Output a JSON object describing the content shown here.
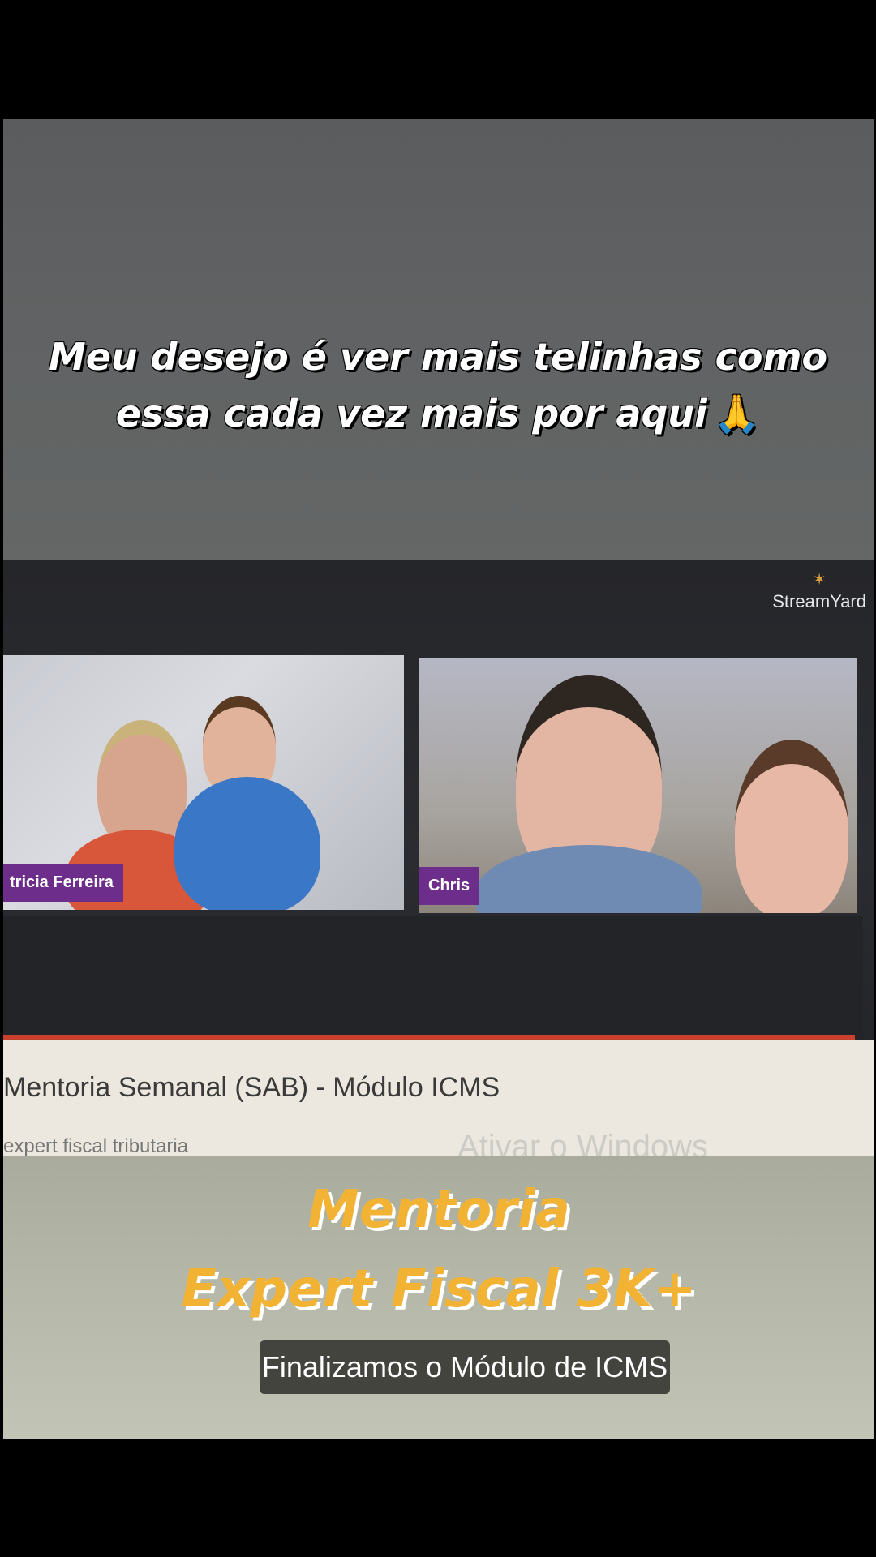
{
  "caption": {
    "line1": "Meu desejo é ver mais telinhas como",
    "line2": "essa cada vez mais por aqui",
    "emoji": "🙏"
  },
  "video": {
    "logo_text": "StreamYard",
    "participants": [
      {
        "name": "tricia Ferreira"
      },
      {
        "name": "Chris"
      }
    ],
    "title": "Mentoria Semanal (SAB) - Módulo ICMS",
    "channel": "expert fiscal tributaria",
    "watermark": "Ativar o Windows"
  },
  "promo": {
    "line1": "Mentoria",
    "line2": "Expert Fiscal 3K+"
  },
  "subtitle": "Finalizamos o Módulo de ICMS",
  "colors": {
    "promo": "#f2b233",
    "name_tag": "#6d2d8a",
    "progress_line": "#c9402e"
  }
}
